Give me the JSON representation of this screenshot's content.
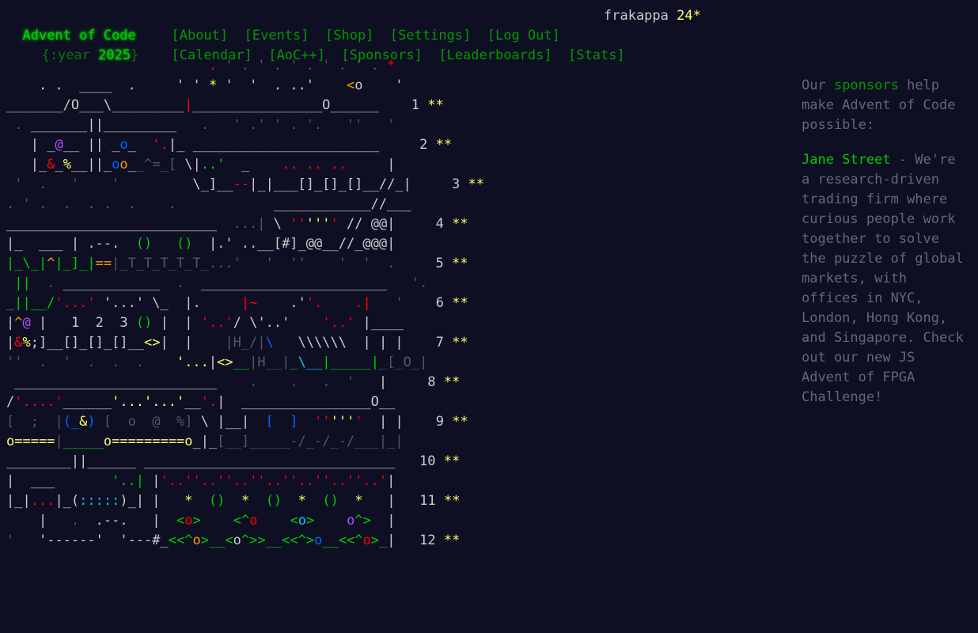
{
  "header": {
    "title": "Advent of Code",
    "year_prefix": "{:year ",
    "year": "2025",
    "year_suffix": "}",
    "nav_row1": [
      "[About]",
      "[Events]",
      "[Shop]",
      "[Settings]",
      "[Log Out]"
    ],
    "nav_row2": [
      "[Calendar]",
      "[AoC++]",
      "[Sponsors]",
      "[Leaderboards]",
      "[Stats]"
    ],
    "username": "frakappa",
    "star_count": "24*"
  },
  "calendar": {
    "days": [
      {
        "day": "1",
        "stars": "**"
      },
      {
        "day": "2",
        "stars": "**"
      },
      {
        "day": "3",
        "stars": "**"
      },
      {
        "day": "4",
        "stars": "**"
      },
      {
        "day": "5",
        "stars": "**"
      },
      {
        "day": "6",
        "stars": "**"
      },
      {
        "day": "7",
        "stars": "**"
      },
      {
        "day": "8",
        "stars": "**"
      },
      {
        "day": "9",
        "stars": "**"
      },
      {
        "day": "10",
        "stars": "**"
      },
      {
        "day": "11",
        "stars": "**"
      },
      {
        "day": "12",
        "stars": "**"
      }
    ]
  },
  "sponsor": {
    "intro_before": "Our ",
    "intro_link": "sponsors",
    "intro_after": " help make Advent of Code possible:",
    "name": "Jane Street",
    "text": " - We're a research-driven trading firm where curious people work together to solve the puzzle of global markets, with offices in NYC, London, Hong Kong, and Singapore. Check out our new JS Advent of FPGA Challenge!"
  },
  "colors": {
    "background": "#0f0f23",
    "green": "#00cc00",
    "star_yellow": "#ffff66",
    "text": "#cccccc"
  }
}
